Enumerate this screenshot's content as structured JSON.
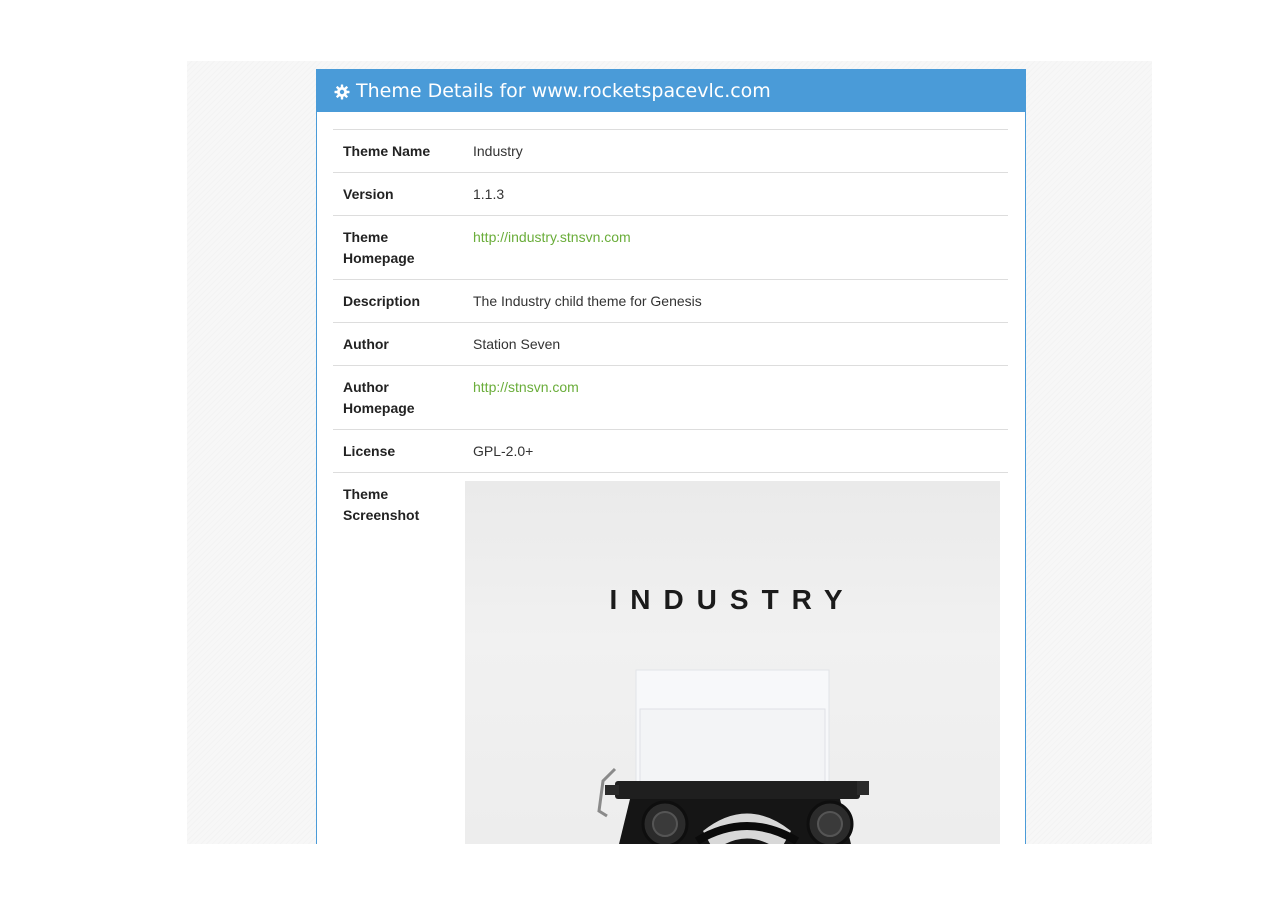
{
  "panel": {
    "title": "Theme Details for www.rocketspacevlc.com",
    "icon": "gear-icon",
    "accent_color": "#4a9bd8",
    "link_color": "#6aad3a"
  },
  "details": {
    "theme_name": {
      "label": "Theme Name",
      "value": "Industry"
    },
    "version": {
      "label": "Version",
      "value": "1.1.3"
    },
    "theme_homepage": {
      "label": "Theme Homepage",
      "value": "http://industry.stnsvn.com"
    },
    "description": {
      "label": "Description",
      "value": "The Industry child theme for Genesis"
    },
    "author": {
      "label": "Author",
      "value": "Station Seven"
    },
    "author_homepage": {
      "label": "Author Homepage",
      "value": "http://stnsvn.com"
    },
    "license": {
      "label": "License",
      "value": "GPL-2.0+"
    },
    "screenshot": {
      "label": "Theme Screenshot",
      "image_text": "INDUSTRY"
    }
  }
}
